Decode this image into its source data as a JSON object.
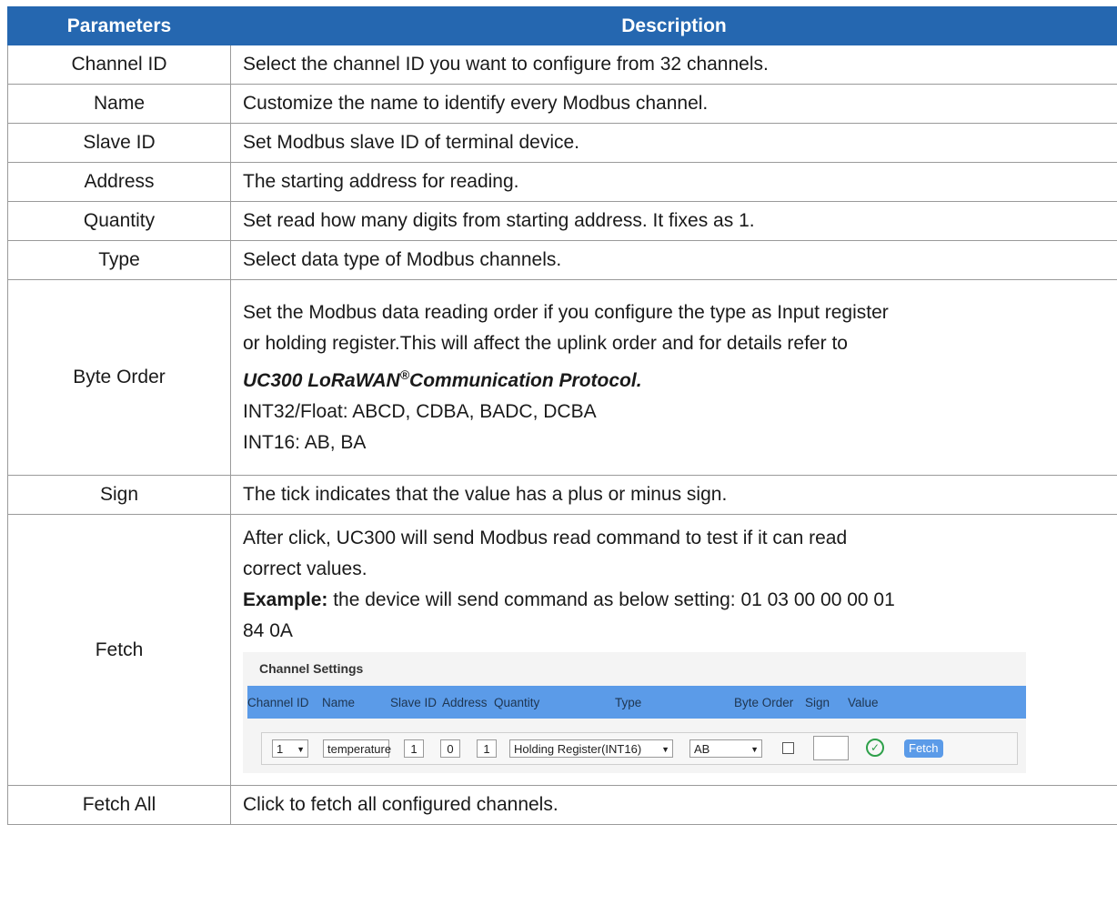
{
  "table": {
    "headers": {
      "parameters": "Parameters",
      "description": "Description"
    },
    "rows": [
      {
        "param": "Channel ID",
        "desc": "Select the channel ID you want to configure from 32 channels."
      },
      {
        "param": "Name",
        "desc": "Customize the name to identify every Modbus channel."
      },
      {
        "param": "Slave ID",
        "desc": "Set Modbus slave ID of terminal device."
      },
      {
        "param": "Address",
        "desc": "The starting address for reading."
      },
      {
        "param": "Quantity",
        "desc": "Set read how many digits from starting address. It fixes as 1."
      },
      {
        "param": "Type",
        "desc": "Select data type of Modbus channels."
      },
      {
        "param": "Byte Order",
        "desc_lines": [
          "Set the Modbus data reading order if you configure the type as Input register",
          "or holding register.This will affect the uplink order and for details refer to"
        ],
        "protocol_a": "UC300 LoRaWAN",
        "protocol_sup": "®",
        "protocol_b": "Communication Protocol",
        "protocol_end": ".",
        "line_int32": "INT32/Float: ABCD, CDBA, BADC, DCBA",
        "line_int16": "INT16: AB, BA"
      },
      {
        "param": "Sign",
        "desc": "The tick indicates that the value has a plus or minus sign."
      },
      {
        "param": "Fetch",
        "desc_lines": [
          "After click, UC300 will send Modbus read command to test if it can read",
          "correct values."
        ],
        "example_label": "Example:",
        "example_text": " the device will send command as below setting: 01 03 00 00 00 01",
        "example_cont": "84 0A"
      },
      {
        "param": "Fetch All",
        "desc": "Click to fetch all configured channels."
      }
    ]
  },
  "screenshot": {
    "title": "Channel Settings",
    "columns": [
      "Channel ID",
      "Name",
      "Slave ID",
      "Address",
      "Quantity",
      "Type",
      "Byte Order",
      "Sign",
      "Value"
    ],
    "values": {
      "channel_id": "1",
      "name": "temperature",
      "slave_id": "1",
      "address": "0",
      "quantity": "1",
      "type": "Holding Register(INT16)",
      "byte_order": "AB",
      "value": ""
    },
    "fetch_label": "Fetch"
  }
}
